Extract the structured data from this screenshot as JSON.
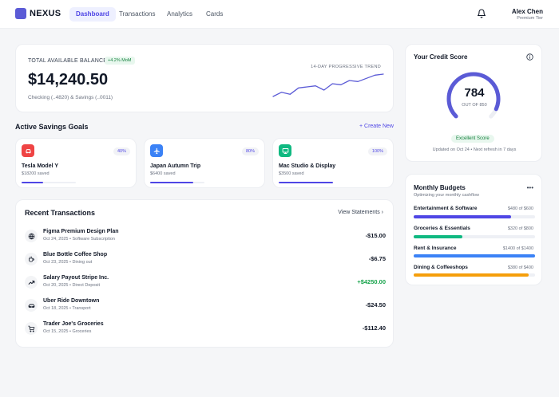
{
  "brand": {
    "name": "NEXUS",
    "color": "#5b5bd6"
  },
  "nav": {
    "items": [
      "Dashboard",
      "Transactions",
      "Analytics",
      "Cards"
    ],
    "active": "Dashboard"
  },
  "user": {
    "name": "Alex Chen",
    "tier": "Premium Tier"
  },
  "balance": {
    "label": "TOTAL AVAILABLE BALANCE",
    "badge": "+4.2% MoM",
    "value": "$14,240.50",
    "sub": "Checking (..4820) & Savings (..0011)",
    "trend_label": "14-DAY PROGRESSIVE TREND",
    "trend": [
      4,
      6,
      5,
      8,
      8.5,
      9,
      7,
      10,
      9.5,
      11.5,
      11,
      12.5,
      14,
      14.5
    ]
  },
  "goals": {
    "title": "Active Savings Goals",
    "create_label": "+ Create New",
    "items": [
      {
        "name": "Tesla Model Y",
        "saved": "$18200 saved",
        "pct_label": "40%",
        "progress": 0.4,
        "icon": "car-icon",
        "icon_color": "#ef4444"
      },
      {
        "name": "Japan Autumn Trip",
        "saved": "$6400 saved",
        "pct_label": "80%",
        "progress": 0.8,
        "icon": "plane-icon",
        "icon_color": "#3b82f6"
      },
      {
        "name": "Mac Studio & Display",
        "saved": "$3500 saved",
        "pct_label": "100%",
        "progress": 1.0,
        "icon": "monitor-icon",
        "icon_color": "#10b981"
      }
    ]
  },
  "transactions": {
    "title": "Recent Transactions",
    "view_label": "View Statements",
    "items": [
      {
        "name": "Figma Premium Design Plan",
        "meta": "Oct 24, 2025 • Software Subscription",
        "amount": "-$15.00",
        "positive": false,
        "icon": "globe-icon"
      },
      {
        "name": "Blue Bottle Coffee Shop",
        "meta": "Oct 23, 2025 • Dining out",
        "amount": "-$6.75",
        "positive": false,
        "icon": "coffee-icon"
      },
      {
        "name": "Salary Payout Stripe Inc.",
        "meta": "Oct 20, 2025 • Direct Deposit",
        "amount": "+$4250.00",
        "positive": true,
        "icon": "trending-up-icon"
      },
      {
        "name": "Uber Ride Downtown",
        "meta": "Oct 18, 2025 • Transport",
        "amount": "-$24.50",
        "positive": false,
        "icon": "car-icon"
      },
      {
        "name": "Trader Joe's Groceries",
        "meta": "Oct 15, 2025 • Groceries",
        "amount": "-$112.40",
        "positive": false,
        "icon": "cart-icon"
      }
    ]
  },
  "credit": {
    "title": "Your Credit Score",
    "score": "784",
    "out_of": "OUT OF 850",
    "fraction": 0.922,
    "badge": "Excellent Score",
    "updated": "Updated on Oct 24 • Next refresh in 7 days"
  },
  "budgets": {
    "title": "Monthly Budgets",
    "sub": "Optimizing your monthly cashflow",
    "items": [
      {
        "name": "Entertainment & Software",
        "amount": "$480 of $600",
        "progress": 0.8,
        "color": "#4f46e5"
      },
      {
        "name": "Groceries & Essentials",
        "amount": "$320 of $800",
        "progress": 0.4,
        "color": "#10b981"
      },
      {
        "name": "Rent & Insurance",
        "amount": "$1400 of $1400",
        "progress": 1.0,
        "color": "#3b82f6"
      },
      {
        "name": "Dining & Coffeeshops",
        "amount": "$380 of $400",
        "progress": 0.95,
        "color": "#f59e0b"
      }
    ]
  }
}
